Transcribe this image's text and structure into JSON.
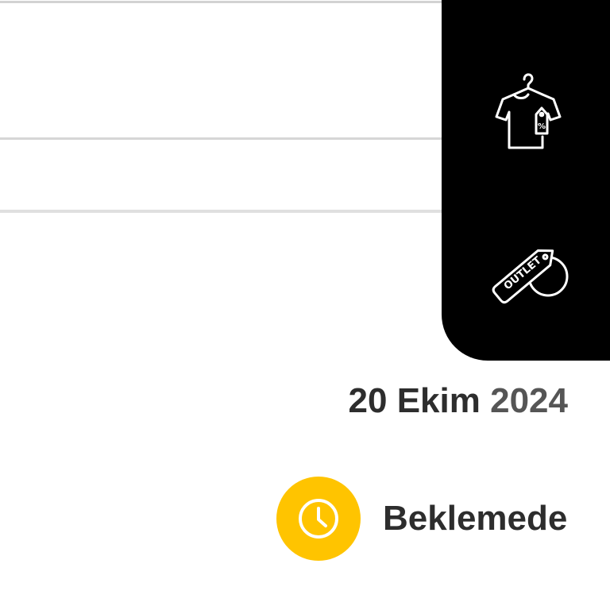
{
  "side_menu": {
    "items": [
      {
        "icon": "tshirt-discount-icon"
      },
      {
        "icon": "outlet-tag-icon",
        "tag_text": "OUTLET"
      }
    ]
  },
  "order": {
    "date_day_month": "20 Ekim",
    "date_year": "2024",
    "status_label": "Beklemede",
    "status_icon": "clock-icon",
    "status_color": "#ffc400"
  },
  "colors": {
    "panel_bg": "#000000",
    "text_primary": "#2d2d2d",
    "accent": "#ffc400"
  }
}
